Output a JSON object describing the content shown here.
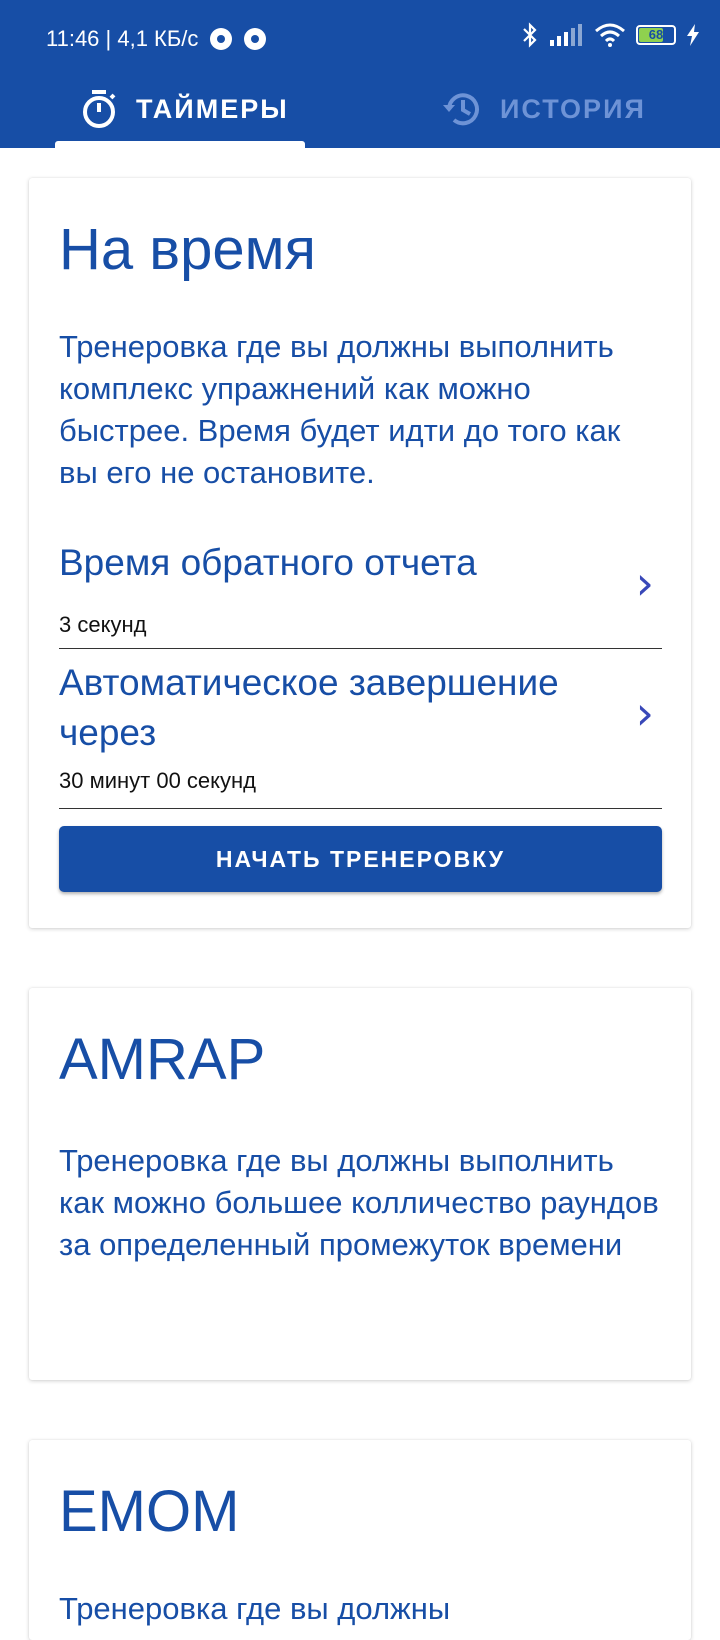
{
  "status": {
    "time_speed": "11:46 | 4,1 КБ/с",
    "battery": "68"
  },
  "tabs": [
    {
      "label": "ТАЙМЕРЫ",
      "icon": "stopwatch-icon",
      "selected": true
    },
    {
      "label": "ИСТОРИЯ",
      "icon": "history-icon",
      "selected": false
    }
  ],
  "cards": [
    {
      "title": "На время",
      "description": "Тренеровка где вы должны выполнить комплекс упражнений как можно быстрее. Время будет идти до того как вы его не остановите.",
      "settings": [
        {
          "label": "Время обратного отчета",
          "value": "3 секунд"
        },
        {
          "label": "Автоматическое завершение через",
          "value": "30 минут 00 секунд"
        }
      ],
      "button": "НАЧАТЬ ТРЕНЕРОВКУ"
    },
    {
      "title": "AMRAP",
      "description": "Тренеровка где вы должны выполнить как можно большее колличество раундов за определенный промежуток времени"
    },
    {
      "title": "EMOM",
      "description": "Тренеровка где вы должны"
    }
  ],
  "colors": {
    "primary": "#174ea6",
    "chevron": "#3948b8",
    "tab_inactive": "#6e93d6"
  }
}
